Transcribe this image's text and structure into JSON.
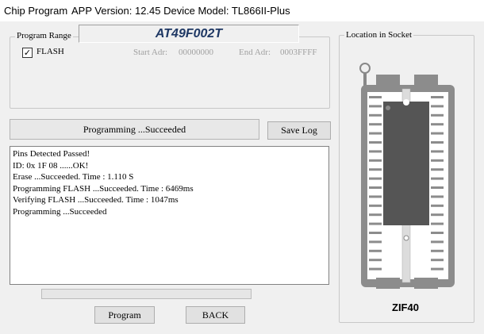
{
  "window": {
    "title": "Chip Program",
    "app_version": "APP Version: 12.45 Device Model: TL866II-Plus"
  },
  "program_range": {
    "group_label": "Program Range",
    "chip_name": "AT49F002T",
    "flash_checked": true,
    "flash_check_glyph": "✓",
    "flash_label": "FLASH",
    "start_label": "Start Adr:",
    "start_value": "00000000",
    "end_label": "End Adr:",
    "end_value": "0003FFFF"
  },
  "status": {
    "text": "Programming  ...Succeeded"
  },
  "buttons": {
    "save_log": "Save Log",
    "program": "Program",
    "back": "BACK"
  },
  "log_lines": [
    "Pins Detected Passed!",
    "ID: 0x 1F 08 ......OK!",
    "Erase  ...Succeeded. Time : 1.110 S",
    "Programming FLASH ...Succeeded. Time : 6469ms",
    "Verifying FLASH ...Succeeded. Time : 1047ms",
    "Programming  ...Succeeded"
  ],
  "progress": {
    "value": 0
  },
  "socket": {
    "group_label": "Location in Socket",
    "socket_name": "ZIF40",
    "chip_color": "#555555",
    "socket_color": "#8c8c8c"
  }
}
